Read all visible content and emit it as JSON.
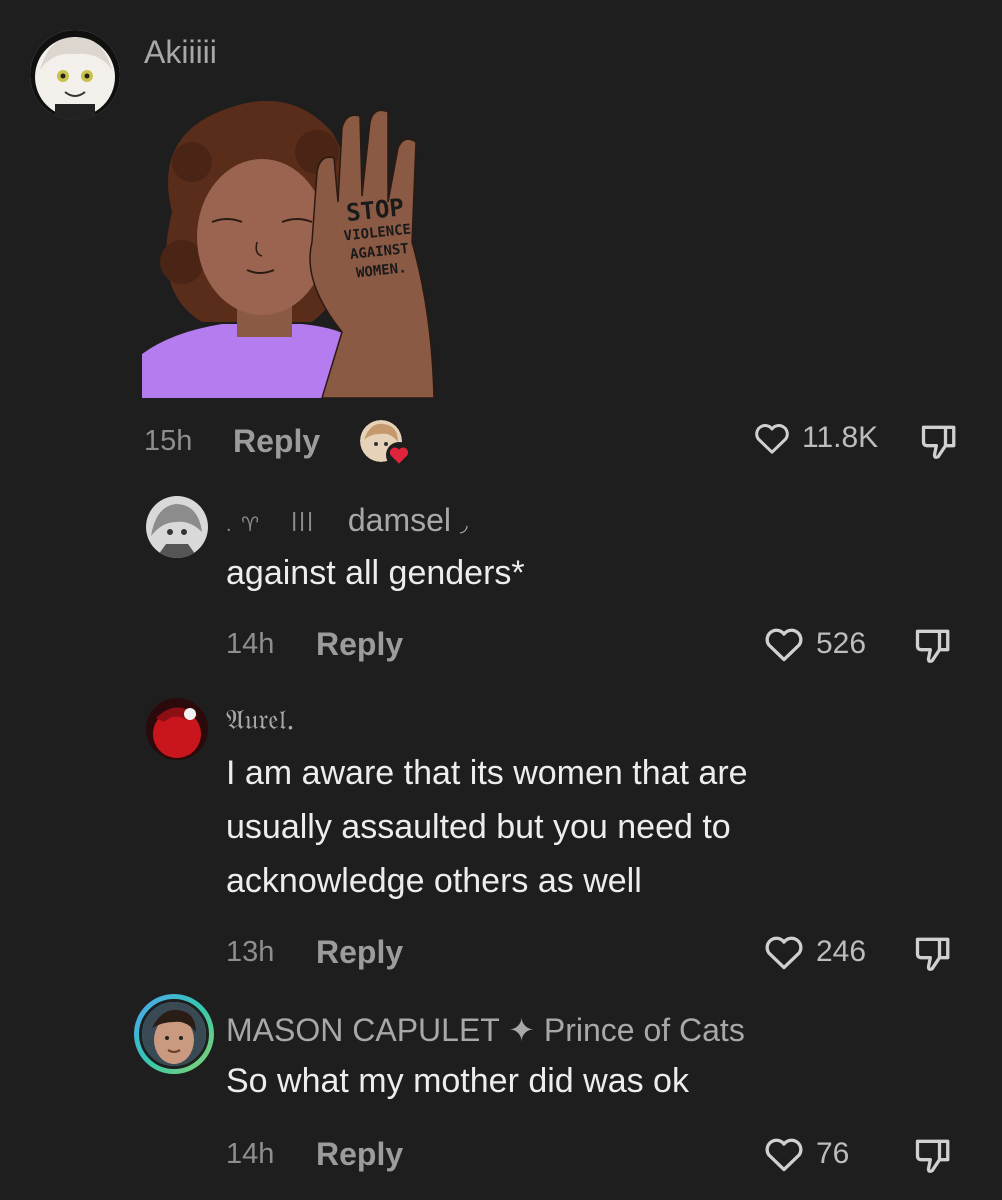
{
  "comments": [
    {
      "username": "Akiiiii",
      "time": "15h",
      "reply_label": "Reply",
      "likes": "11.8K",
      "sticker_lines": [
        "STOP",
        "VIOLENCE",
        "AGAINST",
        "WOMEN."
      ]
    },
    {
      "username": "damsel",
      "username_prefix": ". ♈︎    ꟾꟾꟾ",
      "username_suffix": "◞",
      "text": "against all genders*",
      "time": "14h",
      "reply_label": "Reply",
      "likes": "526"
    },
    {
      "username": "𝔄𝔲𝔯𝔢𝔩.",
      "text_lines": [
        "I am aware that its women that are",
        "usually assaulted but you need to",
        "acknowledge others as well"
      ],
      "time": "13h",
      "reply_label": "Reply",
      "likes": "246"
    },
    {
      "username": "MASON CAPULET ✦ Prince of Cats",
      "text": "So what my mother did was ok",
      "time": "14h",
      "reply_label": "Reply",
      "likes": "76"
    }
  ],
  "colors": {
    "background": "#1e1e1e",
    "sticker_shirt": "#b57cf0",
    "skin": "#8b5a45",
    "hair": "#5a2d1a",
    "heart_badge": "#e0243e"
  }
}
